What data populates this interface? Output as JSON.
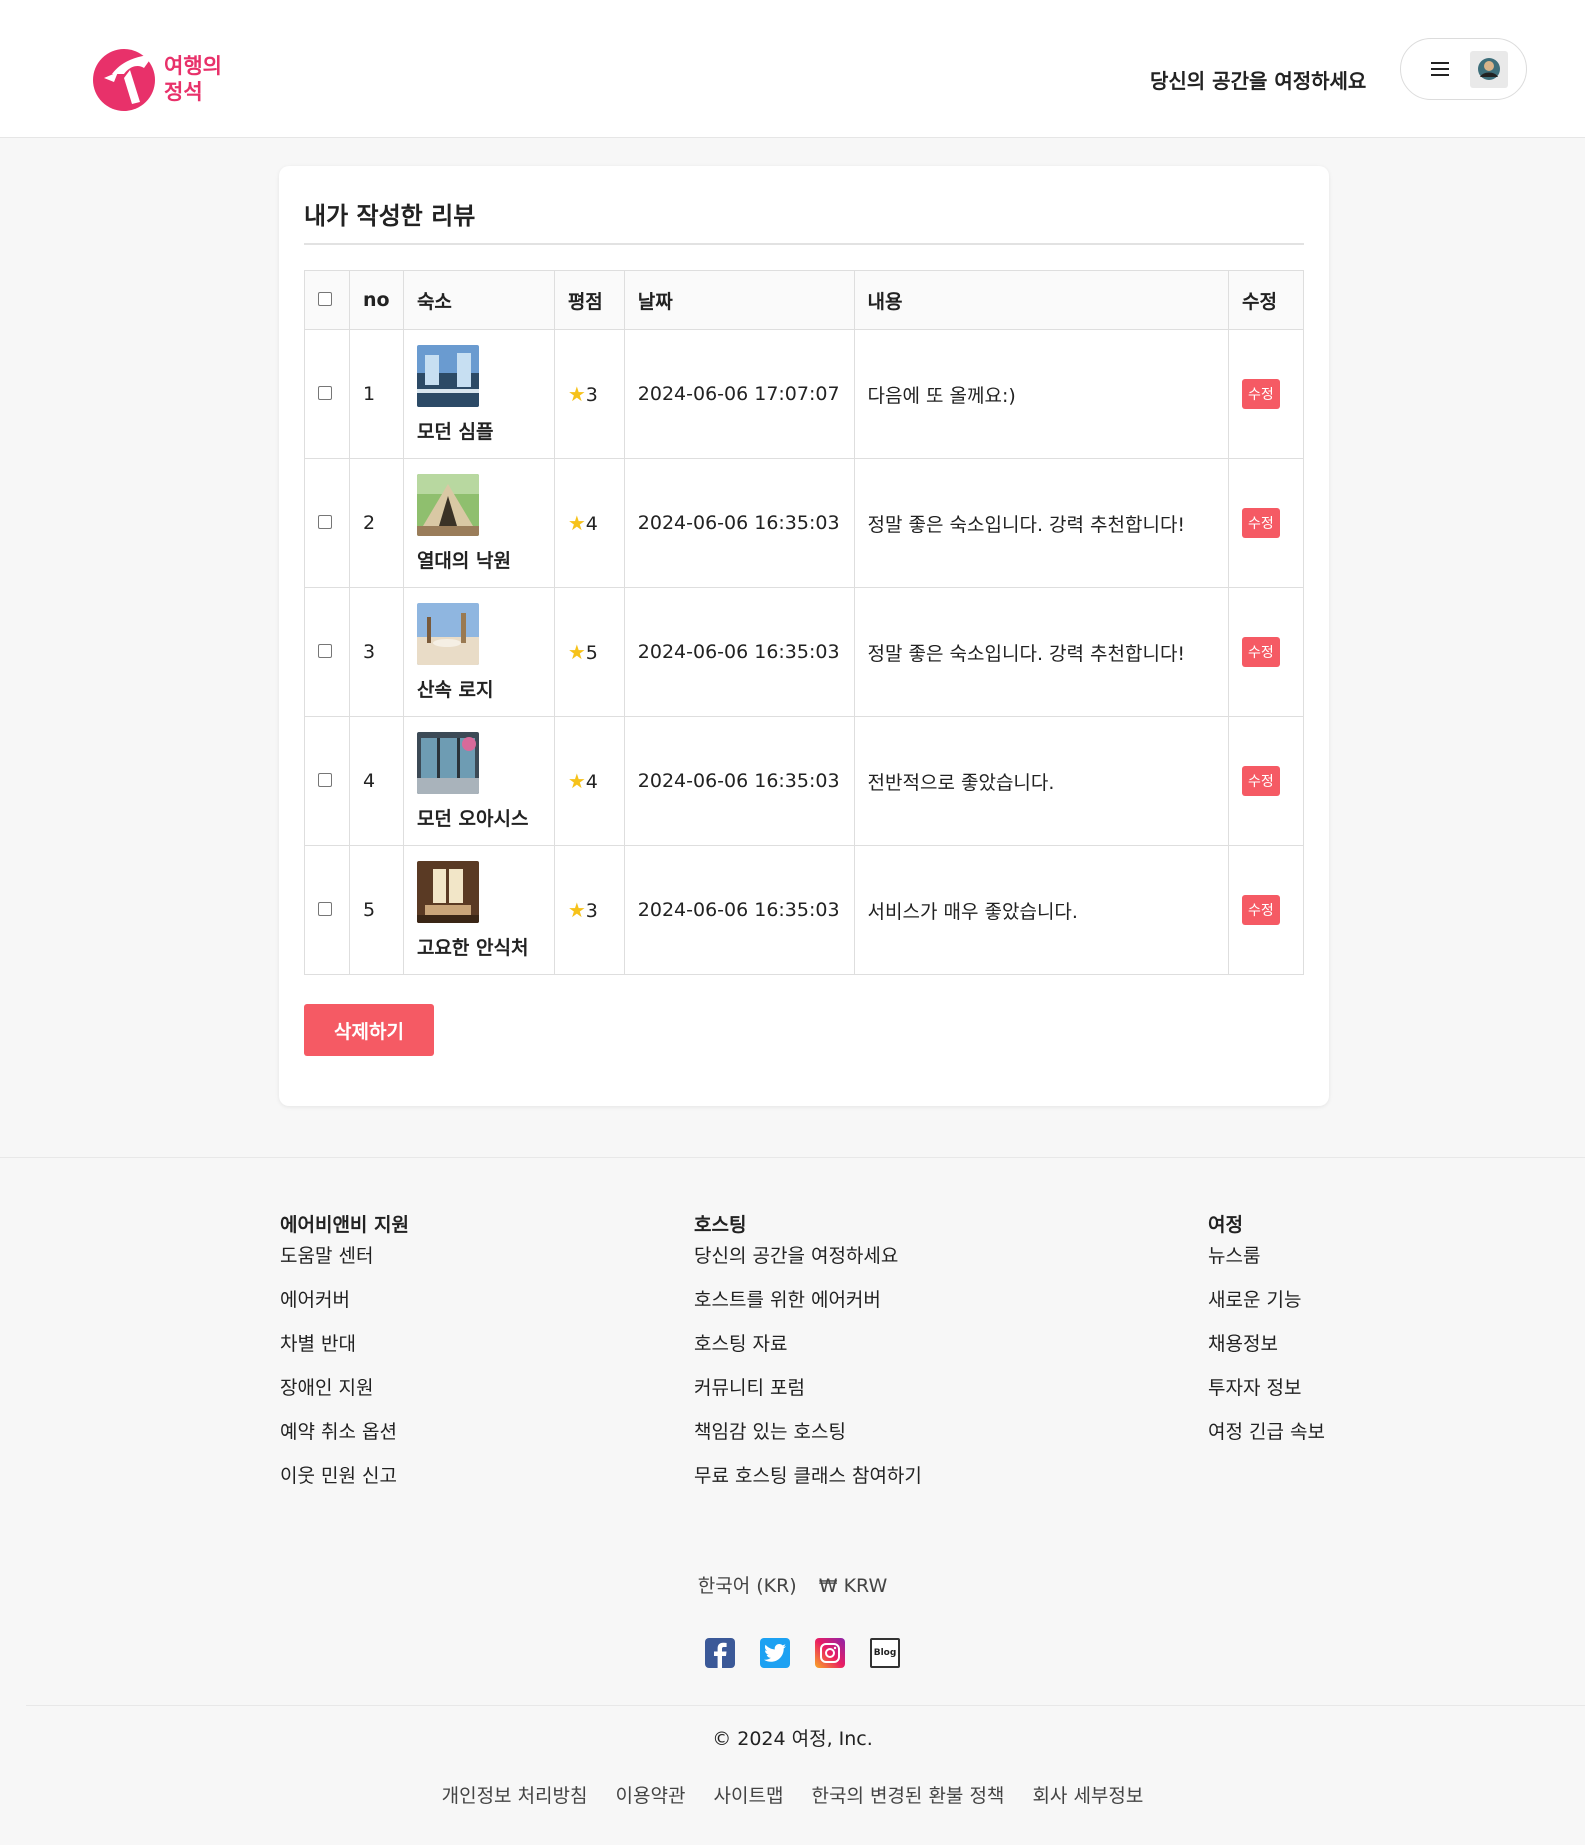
{
  "header": {
    "logo_text_line1": "여행의",
    "logo_text_line2": "정석",
    "host_link": "당신의 공간을 여정하세요"
  },
  "reviews": {
    "title": "내가 작성한 리뷰",
    "columns": [
      "no",
      "숙소",
      "평점",
      "날짜",
      "내용",
      "수정"
    ],
    "rows": [
      {
        "no": "1",
        "room": "모던 심플",
        "rating": "3",
        "date": "2024-06-06 17:07:07",
        "content": "다음에 또 올께요:)",
        "edit": "수정"
      },
      {
        "no": "2",
        "room": "열대의 낙원",
        "rating": "4",
        "date": "2024-06-06 16:35:03",
        "content": "정말 좋은 숙소입니다. 강력 추천합니다!",
        "edit": "수정"
      },
      {
        "no": "3",
        "room": "산속 로지",
        "rating": "5",
        "date": "2024-06-06 16:35:03",
        "content": "정말 좋은 숙소입니다. 강력 추천합니다!",
        "edit": "수정"
      },
      {
        "no": "4",
        "room": "모던 오아시스",
        "rating": "4",
        "date": "2024-06-06 16:35:03",
        "content": "전반적으로 좋았습니다.",
        "edit": "수정"
      },
      {
        "no": "5",
        "room": "고요한 안식처",
        "rating": "3",
        "date": "2024-06-06 16:35:03",
        "content": "서비스가 매우 좋았습니다.",
        "edit": "수정"
      }
    ],
    "delete_label": "삭제하기"
  },
  "footer": {
    "columns": [
      {
        "heading": "에어비앤비 지원",
        "links": [
          "도움말 센터",
          "에어커버",
          "차별 반대",
          "장애인 지원",
          "예약 취소 옵션",
          "이웃 민원 신고"
        ]
      },
      {
        "heading": "호스팅",
        "links": [
          "당신의 공간을 여정하세요",
          "호스트를 위한 에어커버",
          "호스팅 자료",
          "커뮤니티 포럼",
          "책임감 있는 호스팅",
          "무료 호스팅 클래스 참여하기"
        ]
      },
      {
        "heading": "여정",
        "links": [
          "뉴스룸",
          "새로운 기능",
          "채용정보",
          "투자자 정보",
          "여정 긴급 속보"
        ]
      }
    ],
    "language": "한국어 (KR)",
    "currency": "₩ KRW",
    "social_icons": [
      "facebook-icon",
      "twitter-icon",
      "instagram-icon",
      "blog-icon"
    ],
    "blog_icon_text": "Blog",
    "copyright": "© 2024 여정, Inc.",
    "legal_links": [
      "개인정보 처리방침",
      "이용약관",
      "사이트맵",
      "한국의 변경된 환불 정책",
      "회사 세부정보"
    ]
  },
  "colors": {
    "brand": "#e8316a",
    "accent_button": "#f55a64",
    "star": "#f6c21a"
  }
}
